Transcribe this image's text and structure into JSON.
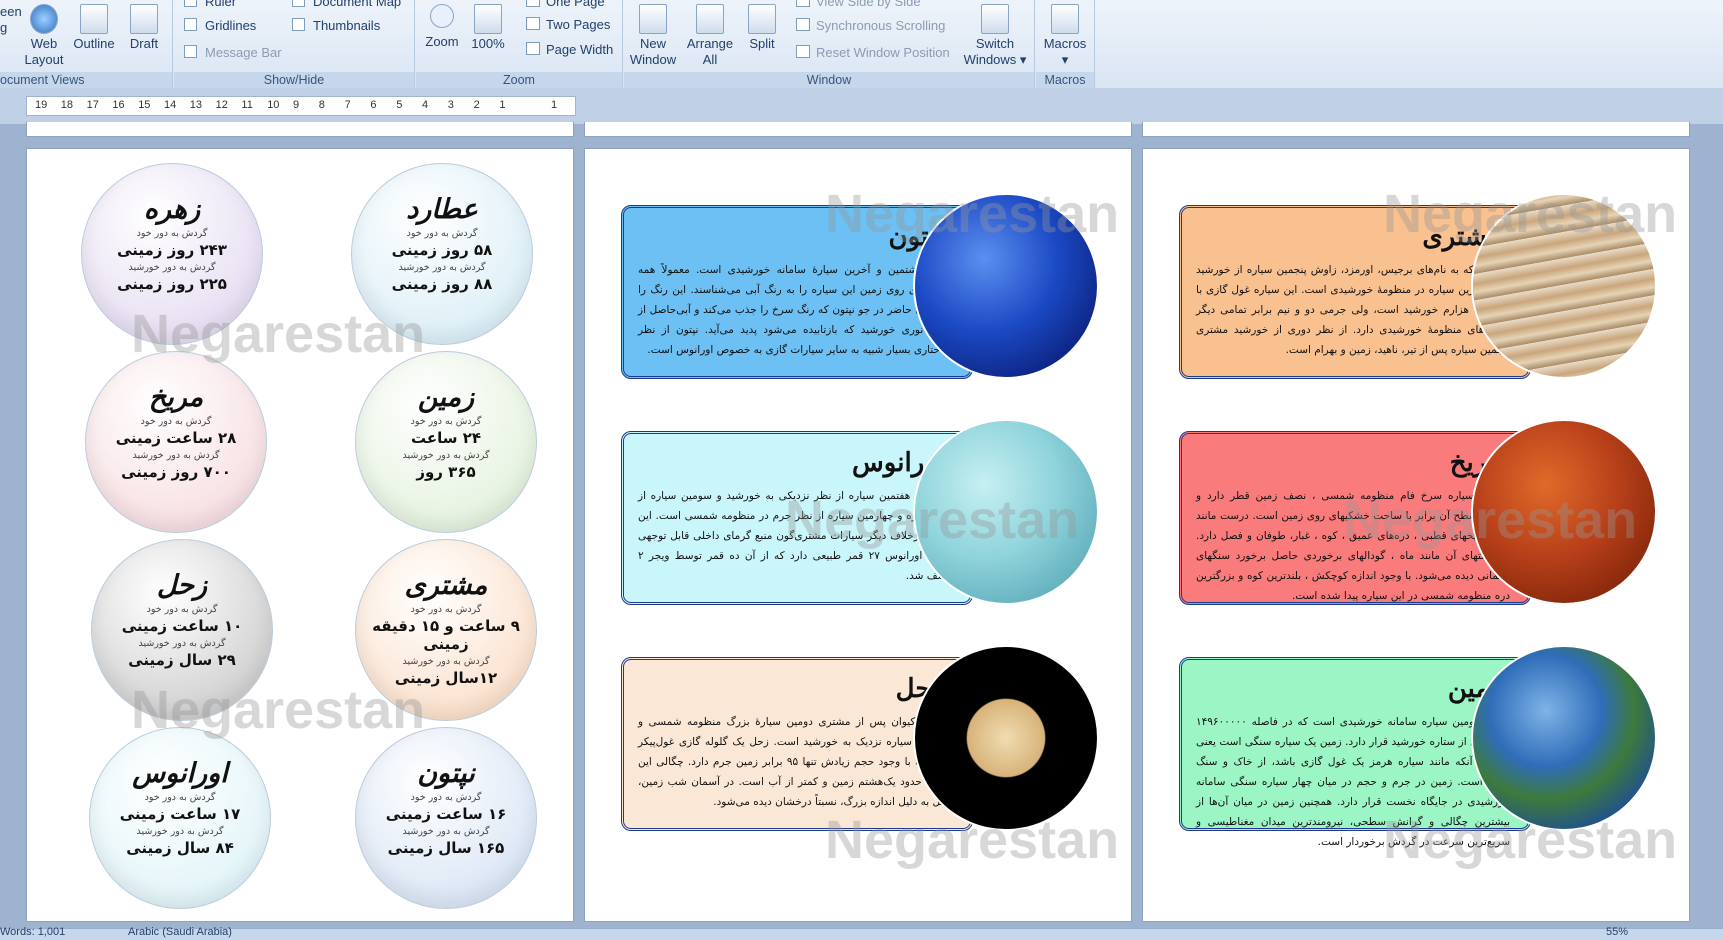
{
  "ribbon": {
    "views_group": {
      "label": "ocument Views",
      "buttons": [
        "een\ng",
        "Web\nLayout",
        "Outline",
        "Draft"
      ]
    },
    "showhide_group": {
      "label": "Show/Hide",
      "ruler": "Ruler",
      "gridlines": "Gridlines",
      "message_bar": "Message Bar",
      "document_map": "Document Map",
      "thumbnails": "Thumbnails"
    },
    "zoom_group": {
      "label": "Zoom",
      "zoom": "Zoom",
      "percent": "100%",
      "one_page": "One Page",
      "two_pages": "Two Pages",
      "page_width": "Page Width"
    },
    "window_group": {
      "label": "Window",
      "new_window": "New\nWindow",
      "arrange_all": "Arrange\nAll",
      "split": "Split",
      "view_side": "View Side by Side",
      "sync_scroll": "Synchronous Scrolling",
      "reset_pos": "Reset Window Position",
      "switch_windows": "Switch\nWindows ▾"
    },
    "macros_group": {
      "label": "Macros",
      "macros": "Macros\n▾"
    }
  },
  "ruler": {
    "ticks": [
      "19",
      "18",
      "17",
      "16",
      "15",
      "14",
      "13",
      "12",
      "11",
      "10",
      "9",
      "8",
      "7",
      "6",
      "5",
      "4",
      "3",
      "2",
      "1",
      "",
      "1"
    ]
  },
  "watermark": "Negarestan",
  "page1": {
    "circles": [
      {
        "title": "زهره",
        "l1": "گردش به دور خود",
        "v1": "۲۴۳ روز زمینی",
        "l2": "گردش به دور خورشید",
        "v2": "۲۲۵ روز زمینی",
        "color": "#e6ddf2"
      },
      {
        "title": "عطارد",
        "l1": "گردش به دور خود",
        "v1": "۵۸ روز زمینی",
        "l2": "گردش به دور خورشید",
        "v2": "۸۸ روز زمینی",
        "color": "#dceff7"
      },
      {
        "title": "مریخ",
        "l1": "گردش به دور خود",
        "v1": "۲۸ ساعت زمینی",
        "l2": "گردش به دور خورشید",
        "v2": "۷۰۰ روز زمینی",
        "color": "#f7dfe2"
      },
      {
        "title": "زمین",
        "l1": "گردش به دور خود",
        "v1": "۲۴ ساعت",
        "l2": "گردش به دور خورشید",
        "v2": "۳۶۵ روز",
        "color": "#e5f2df"
      },
      {
        "title": "زحل",
        "l1": "گردش به دور خود",
        "v1": "۱۰ ساعت زمینی",
        "l2": "گردش به دور خورشید",
        "v2": "۲۹ سال زمینی",
        "color": "#d0d0d0"
      },
      {
        "title": "مشتری",
        "l1": "گردش به دور خود",
        "v1": "۹ ساعت و ۱۵ دقیقه زمینی",
        "l2": "گردش به دور خورشید",
        "v2": "۱۲سال زمینی",
        "color": "#fbe1cd"
      },
      {
        "title": "اورانوس",
        "l1": "گردش به دور خود",
        "v1": "۱۷ ساعت زمینی",
        "l2": "گردش به دور خورشید",
        "v2": "۸۴ سال زمینی",
        "color": "#e2f4f8"
      },
      {
        "title": "نپتون",
        "l1": "گردش به دور خود",
        "v1": "۱۶ ساعت زمینی",
        "l2": "گردش به دور خورشید",
        "v2": "۱۶۵ سال زمینی",
        "color": "#dbe6f5"
      }
    ]
  },
  "page2": {
    "cards": [
      {
        "title": "نپتون",
        "body": "نپتون هشتمین و آخرین سیارهٔ سامانه خورشیدی است. معمولاً همه انسان‌های روی زمین این سیاره را به رنگ آبی می‌شناسند. این رنگ را گاز متان حاضر در جو نپتون که رنگ سرخ را جذب می‌کند و آبی‌حاصل از طیف نوری خورشید که بازتابیده می‌شود پدید می‌آید. نپتون از نظر ساختاری بسیار شبیه به سایر سیارات گازی به خصوص اورانوس است.",
        "color": "#6cc0f4"
      },
      {
        "title": "اورانوس",
        "body": "اورانوس هفتمین سیاره از نظر نزدیکی به خورشید و سومین سیاره از نظر اندازه و چهارمین سیاره از نظر جرم در منظومه شمسی است. این سیاره برخلاف دیگر سیارات مشتری‌گون منبع گرمای داخلی قابل توجهی ندارد. اورانوس ۲۷ قمر طبیعی دارد که از آن ده قمر توسط ویجر ۲ کشف شد.",
        "color": "#c9f6fb"
      },
      {
        "title": "زحل",
        "body": "زُحَل یا کیوان پس از مشتری دومین سیارهٔ بزرگ منظومه شمسی و ششمین سیاره نزدیک به خورشید است. زحل یک گلوله گازی غول‌پیکر است که با وجود حجم زیادش تنها ۹۵ برابر زمین جرم دارد. چگالی این سیاره حدود یک‌هشتم زمین و کمتر از آب است. در آسمان شب زمین، زحل به دلیل اندازه بزرگ، نسبتاً درخشان دیده می‌شود.",
        "color": "#fbe7d6"
      }
    ]
  },
  "page3": {
    "cards": [
      {
        "title": "مشتری",
        "body": "مُشتَری که به نام‌های برجیس، اورمزد، زاوش پنجمین سیاره از خورشید و بزرگ‌ترین سیاره در منظومهٔ خورشیدی است. این سیاره غول گازی با جرم یک هزارم خورشید است، ولی جرمی دو و نیم برابر تمامی دیگر سیاره‌های منظومهٔ خورشیدی دارد. از نظر دوری از خورشید مشتری پنجمین سیاره پس از تیر، ناهید، زمین و بهرام است.",
        "color": "#f9c18f"
      },
      {
        "title": "مریخ",
        "body": "مریخ ، سیاره سرخ فام منظومه شمسی ، نصف زمین قطر دارد و ساحت سطح آن برابر با ساحت خشکیهای روی زمین است. درست مانند زمین ، یخهای قطبی ، دره‌های عمیق ، کوه ، غبار، طوفان و فصل دارد. در دشتهای آن مانند ماه ، گودالهای برخوردی حاصل برخورد سنگهای آسمانی دیده می‌شود. با وجود اندازه کوچکش ، بلندترین کوه و بزرگترین دره منظومه شمسی در این سیاره پیدا شده است.",
        "color": "#fa7b7b"
      },
      {
        "title": "زمین",
        "body": "زمین سومین سیاره سامانه خورشیدی است که در فاصله ۱۴۹۶۰۰۰۰۰ کیلومتری از ستاره خورشید قرار دارد. زمین یک سیاره سنگی است یعنی به جای آنکه مانند سیاره هرمز یک غول گازی باشد، از خاک و سنگ ساخته‌است. زمین در جرم و حجم در میان چهار سیاره سنگی سامانه خورشیدی در جایگاه نخست قرار دارد. همچنین زمین در میان آن‌ها از بیشترین چگالی و گرانش سطحی، نیرومندترین میدان مغناطیسی و سریع‌ترین سرعت در گردش برخوردار است.",
        "color": "#9bf5c4"
      }
    ]
  },
  "status": {
    "words": "Words: 1,001",
    "language": "Arabic (Saudi Arabia)",
    "zoom": "55%"
  }
}
